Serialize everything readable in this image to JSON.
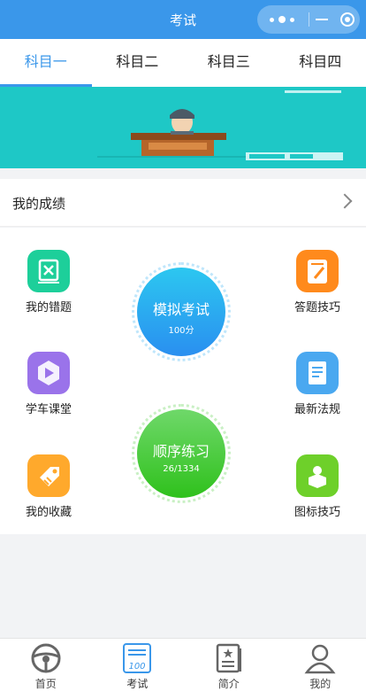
{
  "header": {
    "title": "考试"
  },
  "tabs": [
    {
      "label": "科目一",
      "active": true
    },
    {
      "label": "科目二",
      "active": false
    },
    {
      "label": "科目三",
      "active": false
    },
    {
      "label": "科目四",
      "active": false
    }
  ],
  "score": {
    "label": "我的成绩"
  },
  "items": {
    "wrong": {
      "label": "我的错题",
      "icon": "wrong-questions-icon",
      "color": "#1dcf9a"
    },
    "tips": {
      "label": "答题技巧",
      "icon": "answer-tips-icon",
      "color": "#ff8a1c"
    },
    "course": {
      "label": "学车课堂",
      "icon": "course-icon",
      "color": "#9a73ea"
    },
    "laws": {
      "label": "最新法规",
      "icon": "laws-icon",
      "color": "#4aa8f0"
    },
    "fav": {
      "label": "我的收藏",
      "icon": "favorites-icon",
      "color": "#ffa92c"
    },
    "signs": {
      "label": "图标技巧",
      "icon": "signs-icon",
      "color": "#6ed02a"
    }
  },
  "mock_exam": {
    "title": "模拟考试",
    "sub": "100分",
    "color": "#2a9cf0"
  },
  "practice": {
    "title": "顺序练习",
    "sub": "26/1334",
    "progress": {
      "done": 26,
      "total": 1334
    },
    "color": "#4ccf26"
  },
  "nav": [
    {
      "label": "首页",
      "icon": "steering-wheel-icon",
      "active": false
    },
    {
      "label": "考试",
      "icon": "exam-icon",
      "active": true
    },
    {
      "label": "简介",
      "icon": "intro-icon",
      "active": false
    },
    {
      "label": "我的",
      "icon": "profile-icon",
      "active": false
    }
  ]
}
